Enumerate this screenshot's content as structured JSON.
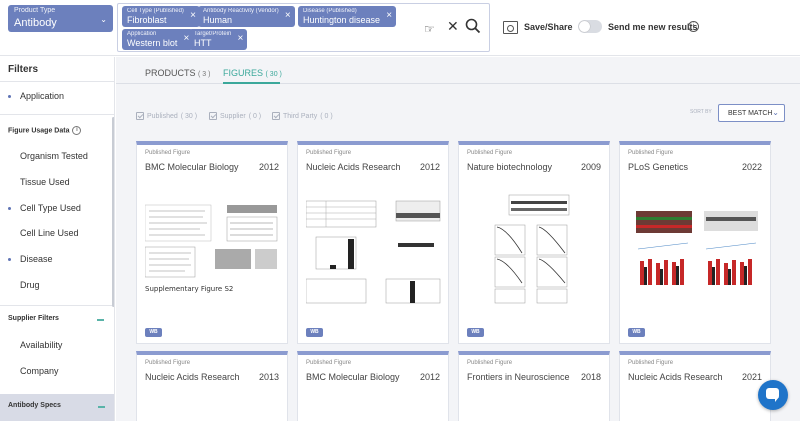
{
  "header": {
    "product_type": {
      "label": "Product Type",
      "value": "Antibody"
    },
    "chips": [
      {
        "label": "Cell Type (Published)",
        "value": "Fibroblast"
      },
      {
        "label": "Antibody Reactivity (Vendor)",
        "value": "Human"
      },
      {
        "label": "Disease (Published)",
        "value": "Huntington disease"
      },
      {
        "label": "Application",
        "value": "Western blot"
      },
      {
        "label": "Target/Protein",
        "value": "HTT"
      }
    ],
    "save_share": "Save/Share",
    "send_results": "Send me new results"
  },
  "sidebar": {
    "title": "Filters",
    "application": "Application",
    "figure_usage_header": "Figure Usage Data",
    "figure_usage_items": [
      "Organism Tested",
      "Tissue Used",
      "Cell Type Used",
      "Cell Line Used",
      "Disease",
      "Drug"
    ],
    "supplier_header": "Supplier Filters",
    "supplier_items": [
      "Availability",
      "Company"
    ],
    "antibody_specs_header": "Antibody Specs"
  },
  "tabs": {
    "products": {
      "label": "PRODUCTS",
      "count": "( 3 )"
    },
    "figures": {
      "label": "FIGURES",
      "count": "( 30 )"
    }
  },
  "filters": {
    "published": {
      "label": "Published",
      "count": "( 30 )"
    },
    "supplier": {
      "label": "Supplier",
      "count": "( 0 )"
    },
    "third_party": {
      "label": "Third Party",
      "count": "( 0 )"
    }
  },
  "sort": {
    "label": "SORT BY",
    "value": "BEST MATCH"
  },
  "cards": [
    {
      "kind": "Published Figure",
      "journal": "BMC Molecular Biology",
      "year": "2012",
      "badge": "WB",
      "caption": "Supplementary Figure S2"
    },
    {
      "kind": "Published Figure",
      "journal": "Nucleic Acids Research",
      "year": "2012",
      "badge": "WB"
    },
    {
      "kind": "Published Figure",
      "journal": "Nature biotechnology",
      "year": "2009",
      "badge": "WB"
    },
    {
      "kind": "Published Figure",
      "journal": "PLoS Genetics",
      "year": "2022",
      "badge": "WB"
    },
    {
      "kind": "Published Figure",
      "journal": "Nucleic Acids Research",
      "year": "2013"
    },
    {
      "kind": "Published Figure",
      "journal": "BMC Molecular Biology",
      "year": "2012"
    },
    {
      "kind": "Published Figure",
      "journal": "Frontiers in Neuroscience",
      "year": "2018"
    },
    {
      "kind": "Published Figure",
      "journal": "Nucleic Acids Research",
      "year": "2021"
    }
  ],
  "colors": {
    "accent": "#6c80bd",
    "teal": "#3ba89b",
    "chat": "#1f74c9"
  }
}
